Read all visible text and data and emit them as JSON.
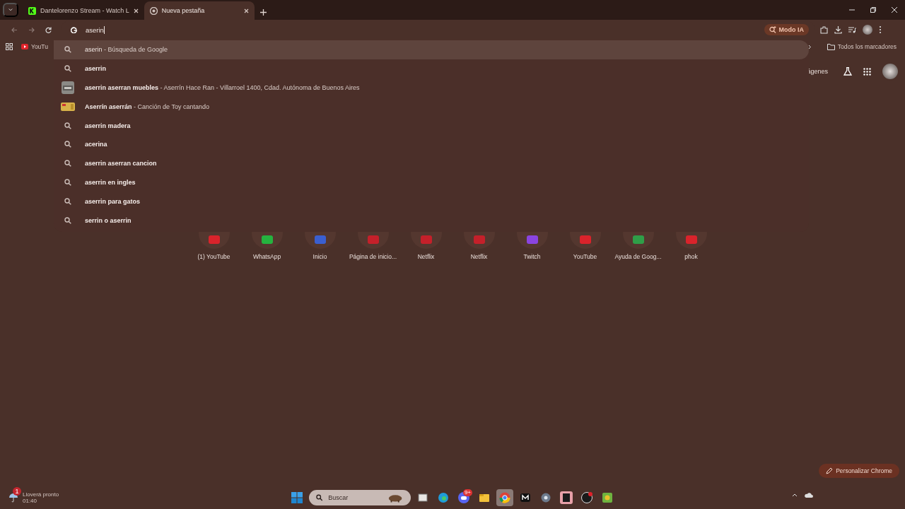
{
  "tabs": [
    {
      "title": "Dantelorenzo Stream - Watch L",
      "selected": false
    },
    {
      "title": "Nueva pestaña",
      "selected": true
    }
  ],
  "omnibox": {
    "value": "aserin",
    "ai_mode_label": "Modo IA"
  },
  "suggestions": [
    {
      "kind": "verbatim",
      "text": "aserin",
      "detail": "- Búsqueda de Google",
      "selected": true
    },
    {
      "kind": "search",
      "text": "aserrin",
      "selected": false
    },
    {
      "kind": "place",
      "text": "aserrin aserran muebles",
      "detail": "- Aserrín Hace Ran - Villarroel 1400, Cdad. Autónoma de Buenos Aires",
      "selected": false
    },
    {
      "kind": "song",
      "text": "Aserrín aserrán",
      "detail": "- Canción de Toy cantando",
      "selected": false
    },
    {
      "kind": "search",
      "text": "aserrin madera",
      "selected": false
    },
    {
      "kind": "search",
      "text": "acerina",
      "selected": false
    },
    {
      "kind": "search",
      "text": "aserrin aserran cancion",
      "selected": false
    },
    {
      "kind": "search",
      "text": "aserrin en ingles",
      "selected": false
    },
    {
      "kind": "search",
      "text": "aserrin para gatos",
      "selected": false
    },
    {
      "kind": "search",
      "text": "serrin o aserrin",
      "selected": false
    }
  ],
  "bookmarks_bar": {
    "items": [
      "YouTu"
    ],
    "all_bookmarks": "Todos los marcadores"
  },
  "ntp": {
    "header_link": "ágenes",
    "shortcuts": [
      {
        "title": "(1) YouTube",
        "color": "#d9232b"
      },
      {
        "title": "WhatsApp",
        "color": "#25b33f"
      },
      {
        "title": "Inicio",
        "color": "#3a5fd0"
      },
      {
        "title": "Página de inicio...",
        "color": "#c4202a"
      },
      {
        "title": "Netflix",
        "color": "#c4202a"
      },
      {
        "title": "Netflix",
        "color": "#c4202a"
      },
      {
        "title": "Twitch",
        "color": "#8a44e0"
      },
      {
        "title": "YouTube",
        "color": "#d9232b"
      },
      {
        "title": "Ayuda de Goog...",
        "color": "#2f9e48"
      },
      {
        "title": "phok",
        "color": "#d9232b"
      }
    ]
  },
  "customize_button": "Personalizar Chrome",
  "taskbar": {
    "weather": {
      "badge": "1",
      "title": "Lloverá pronto",
      "subtitle": "01:40"
    },
    "search_placeholder": "Buscar",
    "apps": [
      {
        "kind": "taskview",
        "active": false
      },
      {
        "kind": "edge",
        "active": false
      },
      {
        "kind": "discord",
        "badge": "9+",
        "active": false
      },
      {
        "kind": "files",
        "active": false
      },
      {
        "kind": "chrome",
        "active": true
      },
      {
        "kind": "mail",
        "active": false
      },
      {
        "kind": "settings",
        "active": false
      },
      {
        "kind": "epic",
        "active": false
      },
      {
        "kind": "obs",
        "active": false
      },
      {
        "kind": "game",
        "active": false
      }
    ]
  }
}
